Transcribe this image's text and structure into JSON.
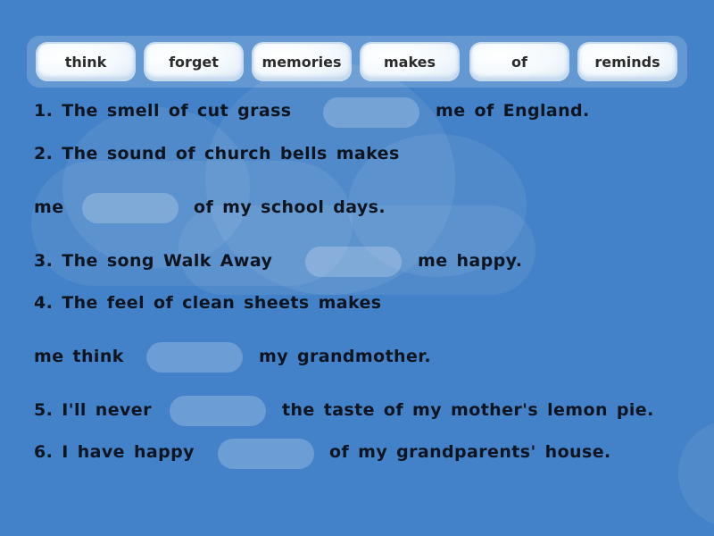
{
  "word_bank": [
    "think",
    "forget",
    "memories",
    "makes",
    "of",
    "reminds"
  ],
  "sentences": {
    "s1": {
      "before": "1. The smell of cut grass",
      "after": "me of England."
    },
    "s2": {
      "line1": "2. The sound of church bells makes",
      "before": "me",
      "after": "of my school days."
    },
    "s3": {
      "before": "3. The song Walk Away",
      "after": "me happy."
    },
    "s4": {
      "line1": "4. The feel of clean sheets makes",
      "before": "me think",
      "after": "my grandmother."
    },
    "s5": {
      "before": "5. I'll never",
      "after": "the taste of my mother's lemon pie."
    },
    "s6": {
      "before": "6. I have happy",
      "after": "of my grandparents' house."
    }
  },
  "colors": {
    "background": "#4382c8",
    "text": "#0e1520",
    "tile_text": "#2b2b2b"
  }
}
